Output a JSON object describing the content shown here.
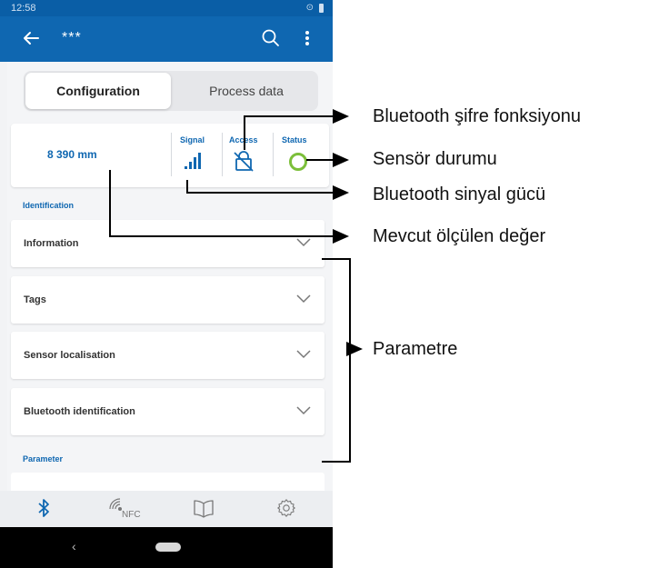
{
  "status_bar": {
    "time": "12:58"
  },
  "app_bar": {
    "title": "***"
  },
  "tabs": [
    {
      "label": "Configuration",
      "active": true
    },
    {
      "label": "Process data",
      "active": false
    }
  ],
  "summary": {
    "measured_value": "8 390 mm",
    "signal_label": "Signal",
    "access_label": "Access",
    "status_label": "Status",
    "status_color": "#7cbf3a"
  },
  "sections": {
    "identification": "Identification",
    "parameter": "Parameter"
  },
  "accordion": [
    {
      "label": "Information"
    },
    {
      "label": "Tags"
    },
    {
      "label": "Sensor localisation"
    },
    {
      "label": "Bluetooth identification"
    }
  ],
  "bottom_nav": [
    "bluetooth-icon",
    "nfc-icon",
    "book-icon",
    "gear-icon"
  ],
  "nav_icon_text": {
    "nfc": "NFC"
  },
  "callouts": {
    "bluetooth_password": "Bluetooth şifre fonksiyonu",
    "sensor_status": "Sensör durumu",
    "signal_strength": "Bluetooth sinyal gücü",
    "current_value": "Mevcut ölçülen değer",
    "parameter": "Parametre"
  },
  "colors": {
    "app_bar": "#0f67b1",
    "accent": "#0f67b1",
    "status_ok": "#7cbf3a"
  }
}
